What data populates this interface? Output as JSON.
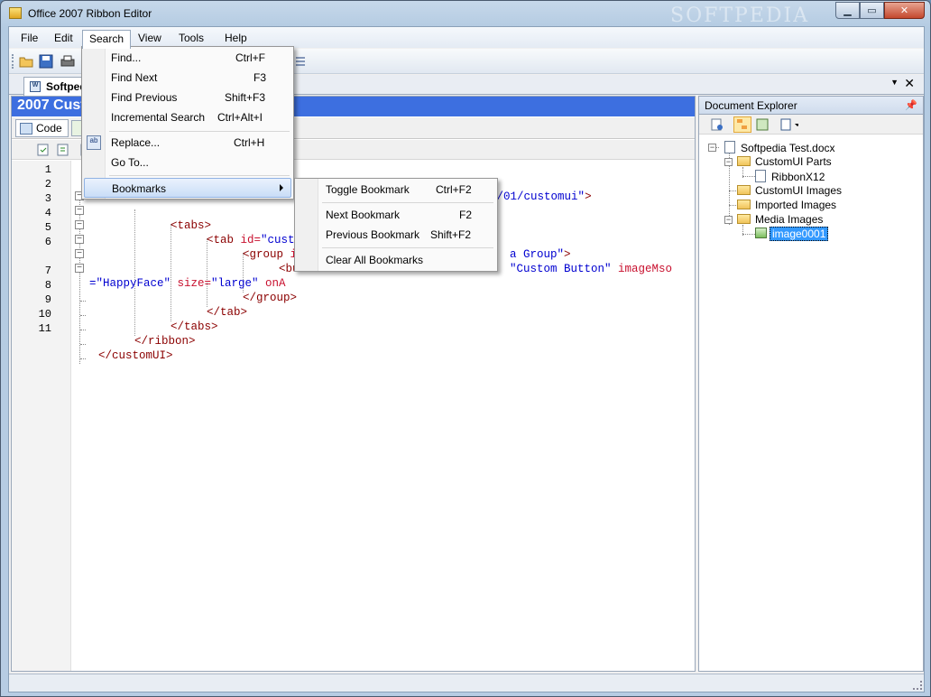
{
  "window": {
    "title": "Office 2007 Ribbon Editor",
    "watermark": "SOFTPEDIA"
  },
  "menubar": {
    "items": [
      "File",
      "Edit",
      "Search",
      "View",
      "Tools",
      "Help"
    ],
    "active": "Search"
  },
  "doc_tab": {
    "label": "Softpedia Test.docx"
  },
  "editor": {
    "header": "2007 Custom UI Part",
    "view_tab": "Code",
    "line_numbers": [
      "1",
      "2",
      "3",
      "4",
      "5",
      "6",
      "7",
      "8",
      "9",
      "10",
      "11"
    ]
  },
  "code_lines": {
    "l1_val": "mas.microsoft.com/office/2006/01/customui\"",
    "l1_tail": ">",
    "l3": "<tabs>",
    "l4_tag": "<tab ",
    "l4_attr": "id=",
    "l4_val": "\"cust",
    "l5_tag": "<group ",
    "l5_attr": "i",
    "l5_val": "a Group\"",
    "l5_tail": ">",
    "l6_tag": "<bu",
    "l6_val": "\"Custom Button\"",
    "l6_attr": " imageMso",
    "l6b_val1": "=\"HappyFace\"",
    "l6b_attr": " size=",
    "l6b_val2": "\"large\"",
    "l6b_attr2": " onA",
    "l7": "</group>",
    "l8": "</tab>",
    "l9": "</tabs>",
    "l10": "</ribbon>",
    "l11": "</customUI>"
  },
  "search_menu": [
    {
      "label": "Find...",
      "shortcut": "Ctrl+F"
    },
    {
      "label": "Find Next",
      "shortcut": "F3"
    },
    {
      "label": "Find Previous",
      "shortcut": "Shift+F3"
    },
    {
      "label": "Incremental Search",
      "shortcut": "Ctrl+Alt+I"
    },
    {
      "label": "Replace...",
      "shortcut": "Ctrl+H"
    },
    {
      "label": "Go To...",
      "shortcut": ""
    },
    {
      "label": "Bookmarks",
      "shortcut": ""
    }
  ],
  "bookmarks_menu": [
    {
      "label": "Toggle Bookmark",
      "shortcut": "Ctrl+F2"
    },
    {
      "label": "Next Bookmark",
      "shortcut": "F2"
    },
    {
      "label": "Previous Bookmark",
      "shortcut": "Shift+F2"
    },
    {
      "label": "Clear All Bookmarks",
      "shortcut": ""
    }
  ],
  "explorer": {
    "title": "Document Explorer",
    "tree": {
      "root": "Softpedia Test.docx",
      "customui_parts": "CustomUI Parts",
      "ribbonx": "RibbonX12",
      "customui_images": "CustomUI Images",
      "imported_images": "Imported Images",
      "media_images": "Media Images",
      "image0001": "image0001"
    }
  },
  "icons": [
    "open-folder-icon",
    "save-icon",
    "print-icon",
    "find-icon",
    "replace-icon",
    "pin-icon",
    "close-icon",
    "folder-icon",
    "image-icon",
    "document-icon"
  ]
}
